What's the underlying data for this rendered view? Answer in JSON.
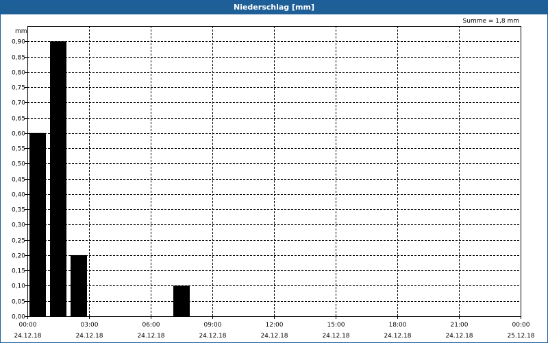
{
  "chart_data": {
    "type": "bar",
    "title": "Niederschlag [mm]",
    "ylabel": "mm",
    "annotation": "Summe = 1,8 mm",
    "ylim": [
      0,
      0.95
    ],
    "y_ticks": [
      "0,00",
      "0,05",
      "0,10",
      "0,15",
      "0,20",
      "0,25",
      "0,30",
      "0,35",
      "0,40",
      "0,45",
      "0,50",
      "0,55",
      "0,60",
      "0,65",
      "0,70",
      "0,75",
      "0,80",
      "0,85",
      "0,90"
    ],
    "x_range_hours": [
      0,
      24
    ],
    "x_ticks": [
      {
        "time": "00:00",
        "date": "24.12.18"
      },
      {
        "time": "03:00",
        "date": "24.12.18"
      },
      {
        "time": "06:00",
        "date": "24.12.18"
      },
      {
        "time": "09:00",
        "date": "24.12.18"
      },
      {
        "time": "12:00",
        "date": "24.12.18"
      },
      {
        "time": "15:00",
        "date": "24.12.18"
      },
      {
        "time": "18:00",
        "date": "24.12.18"
      },
      {
        "time": "21:00",
        "date": "24.12.18"
      },
      {
        "time": "00:00",
        "date": "25.12.18"
      }
    ],
    "bar_width_hours": 1,
    "bars": [
      {
        "start": "00:00",
        "end": "01:00",
        "value": 0.6
      },
      {
        "start": "01:00",
        "end": "02:00",
        "value": 0.9
      },
      {
        "start": "02:00",
        "end": "03:00",
        "value": 0.2
      },
      {
        "start": "07:00",
        "end": "08:00",
        "value": 0.1
      }
    ],
    "grid": true,
    "colors": {
      "bar": "#000000",
      "titlebar": "#1f5f98",
      "grid": "#000000"
    }
  }
}
